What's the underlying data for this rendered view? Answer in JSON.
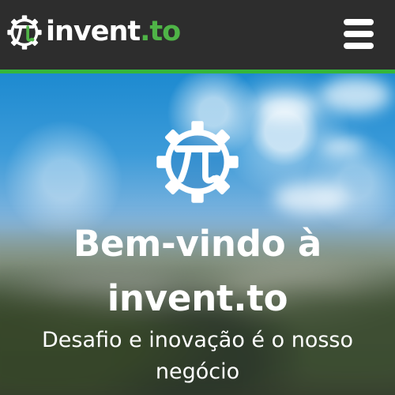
{
  "navbar": {
    "brand": {
      "logo_icon": "pi-gear-logo-icon",
      "name_prefix": "invent",
      "name_suffix": "to"
    },
    "menu_icon": "hamburger-menu-icon"
  },
  "hero": {
    "logo_icon": "pi-gear-logo-icon",
    "title": "Bem-vindo à invent.to",
    "subtitle": "Desafio e inovação é o nosso negócio"
  },
  "colors": {
    "nav_background": "#2d2d2d",
    "brand_green": "#4fb447",
    "accent_green": "#35b63b",
    "text_white": "#ffffff"
  }
}
